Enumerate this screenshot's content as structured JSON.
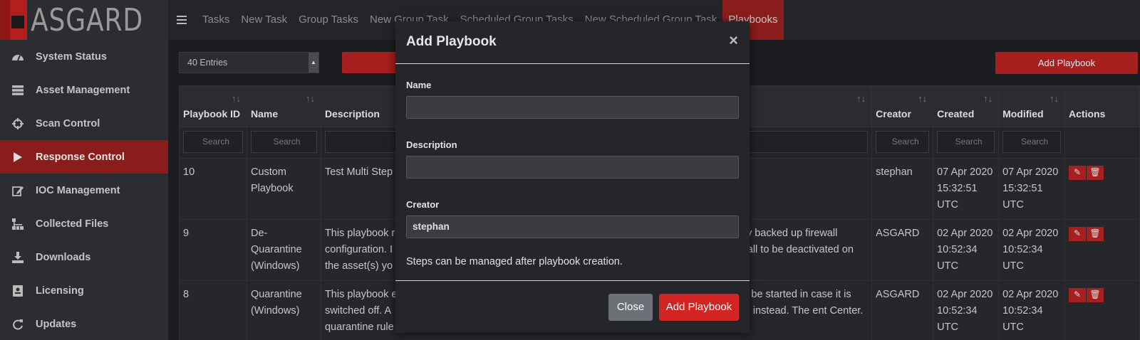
{
  "app": {
    "logo_text": "ASGARD"
  },
  "sidebar": {
    "items": [
      {
        "label": "System Status",
        "icon": "gauge-icon"
      },
      {
        "label": "Asset Management",
        "icon": "server-icon"
      },
      {
        "label": "Scan Control",
        "icon": "crosshair-icon"
      },
      {
        "label": "Response Control",
        "icon": "play-icon",
        "active": true
      },
      {
        "label": "IOC Management",
        "icon": "edit-document-icon"
      },
      {
        "label": "Collected Files",
        "icon": "sitemap-icon"
      },
      {
        "label": "Downloads",
        "icon": "download-icon"
      },
      {
        "label": "Licensing",
        "icon": "license-icon"
      },
      {
        "label": "Updates",
        "icon": "refresh-icon"
      }
    ]
  },
  "topnav": {
    "items": [
      "Tasks",
      "New Task",
      "Group Tasks",
      "New Group Task",
      "Scheduled Group Tasks",
      "New Scheduled Group Task",
      "Playbooks"
    ],
    "active": "Playbooks"
  },
  "toolbar": {
    "entries": "40 Entries",
    "add_playbook": "Add Playbook"
  },
  "table": {
    "headers": {
      "id": "Playbook ID",
      "name": "Name",
      "description": "Description",
      "creator": "Creator",
      "created": "Created",
      "modified": "Modified",
      "actions": "Actions"
    },
    "search_placeholder": "Search",
    "rows": [
      {
        "id": "10",
        "name": "Custom Playbook",
        "description": "Test Multi Step",
        "description_right": "",
        "creator": "stephan",
        "created": "07 Apr 2020 15:32:51 UTC",
        "modified": "07 Apr 2020 15:32:51 UTC"
      },
      {
        "id": "9",
        "name": "De-Quarantine (Windows)",
        "description": "This playbook r configuration. I the asset(s) yo",
        "description_right": "iously backed up firewall firewall to be deactivated on",
        "creator": "ASGARD",
        "created": "02 Apr 2020 10:52:34 UTC",
        "modified": "02 Apr 2020 10:52:34 UTC"
      },
      {
        "id": "8",
        "name": "Quarantine (Windows)",
        "description": "This playbook e switched off. A quarantine rule",
        "description_right": "e will be started in case it is talled instead. The ent Center.",
        "creator": "ASGARD",
        "created": "02 Apr 2020 10:52:34 UTC",
        "modified": "02 Apr 2020 10:52:34 UTC"
      }
    ]
  },
  "modal": {
    "title": "Add Playbook",
    "name_label": "Name",
    "name_value": "",
    "description_label": "Description",
    "description_value": "",
    "creator_label": "Creator",
    "creator_value": "stephan",
    "note": "Steps can be managed after playbook creation.",
    "close_label": "Close",
    "submit_label": "Add Playbook"
  },
  "colors": {
    "accent": "#a71f1f",
    "submit": "#d32424",
    "asgard_green": "#6f9a2e"
  }
}
